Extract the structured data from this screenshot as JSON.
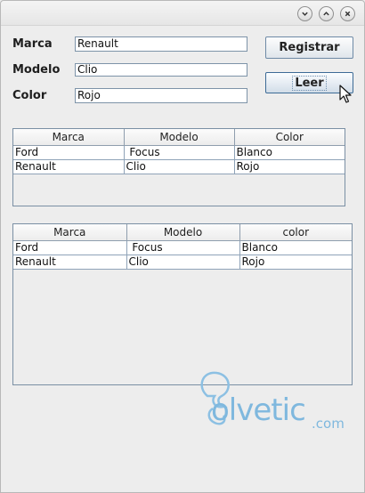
{
  "window": {
    "controls": [
      {
        "name": "minimize-button",
        "icon": "chevron-down-icon"
      },
      {
        "name": "maximize-button",
        "icon": "chevron-up-icon"
      },
      {
        "name": "close-button",
        "icon": "close-icon"
      }
    ]
  },
  "form": {
    "marca_label": "Marca",
    "marca_value": "Renault",
    "modelo_label": "Modelo",
    "modelo_value": "Clio",
    "color_label": "Color",
    "color_value": "Rojo"
  },
  "buttons": {
    "registrar": "Registrar",
    "leer": "Leer"
  },
  "table1": {
    "headers": [
      "Marca",
      "Modelo",
      "Color"
    ],
    "rows": [
      [
        "Ford",
        " Focus",
        "Blanco"
      ],
      [
        "Renault",
        "Clio",
        "Rojo"
      ]
    ]
  },
  "table2": {
    "headers": [
      "Marca",
      "Modelo",
      "color"
    ],
    "rows": [
      [
        "Ford",
        " Focus",
        "Blanco"
      ],
      [
        "Renault",
        "Clio",
        "Rojo"
      ]
    ]
  },
  "watermark": {
    "text": "olvetic",
    "suffix": ".com"
  }
}
